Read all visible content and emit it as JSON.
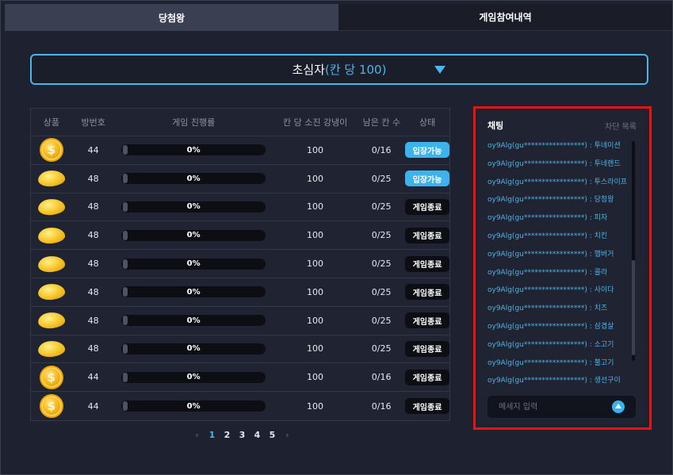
{
  "tabs": [
    {
      "label": "당첨왕",
      "active": true
    },
    {
      "label": "게임참여내역",
      "active": false
    }
  ],
  "selector": {
    "label_main": "초심자",
    "label_accent": "(칸 당 100)"
  },
  "table": {
    "headers": [
      "상품",
      "방번호",
      "게임 진행률",
      "칸 당 소진 강냉이",
      "남은 칸 수",
      "상태"
    ],
    "rows": [
      {
        "prize_icon": "coin-icon",
        "room": "44",
        "progress": "0%",
        "cost": "100",
        "remaining": "0/16",
        "status": "입장가능",
        "status_type": "open"
      },
      {
        "prize_icon": "gold-nugget-icon",
        "room": "48",
        "progress": "0%",
        "cost": "100",
        "remaining": "0/25",
        "status": "입장가능",
        "status_type": "open"
      },
      {
        "prize_icon": "gold-nugget-icon",
        "room": "48",
        "progress": "0%",
        "cost": "100",
        "remaining": "0/25",
        "status": "게임종료",
        "status_type": "end"
      },
      {
        "prize_icon": "gold-nugget-icon",
        "room": "48",
        "progress": "0%",
        "cost": "100",
        "remaining": "0/25",
        "status": "게임종료",
        "status_type": "end"
      },
      {
        "prize_icon": "gold-nugget-icon",
        "room": "48",
        "progress": "0%",
        "cost": "100",
        "remaining": "0/25",
        "status": "게임종료",
        "status_type": "end"
      },
      {
        "prize_icon": "gold-nugget-icon",
        "room": "48",
        "progress": "0%",
        "cost": "100",
        "remaining": "0/25",
        "status": "게임종료",
        "status_type": "end"
      },
      {
        "prize_icon": "gold-nugget-icon",
        "room": "48",
        "progress": "0%",
        "cost": "100",
        "remaining": "0/25",
        "status": "게임종료",
        "status_type": "end"
      },
      {
        "prize_icon": "gold-nugget-icon",
        "room": "48",
        "progress": "0%",
        "cost": "100",
        "remaining": "0/25",
        "status": "게임종료",
        "status_type": "end"
      },
      {
        "prize_icon": "coin-icon",
        "room": "44",
        "progress": "0%",
        "cost": "100",
        "remaining": "0/16",
        "status": "게임종료",
        "status_type": "end"
      },
      {
        "prize_icon": "coin-icon",
        "room": "44",
        "progress": "0%",
        "cost": "100",
        "remaining": "0/16",
        "status": "게임종료",
        "status_type": "end"
      }
    ]
  },
  "pagination": {
    "prev": "‹",
    "next": "›",
    "pages": [
      "1",
      "2",
      "3",
      "4",
      "5"
    ],
    "current": "1"
  },
  "chat": {
    "title": "채팅",
    "block_list": "차단 목록",
    "messages": [
      "oy9Alg(gu*****************) : 투네이션",
      "oy9Alg(gu*****************) : 투네랜드",
      "oy9Alg(gu*****************) : 투스라이프",
      "oy9Alg(gu*****************) : 당첨왕",
      "oy9Alg(gu*****************) : 피자",
      "oy9Alg(gu*****************) : 치킨",
      "oy9Alg(gu*****************) : 햄버거",
      "oy9Alg(gu*****************) : 콜라",
      "oy9Alg(gu*****************) : 사이다",
      "oy9Alg(gu*****************) : 치즈",
      "oy9Alg(gu*****************) : 삼겹살",
      "oy9Alg(gu*****************) : 소고기",
      "oy9Alg(gu*****************) : 불고기",
      "oy9Alg(gu*****************) : 생선구이"
    ],
    "input_placeholder": "메세지 입력",
    "send_icon": "arrow-up-icon"
  },
  "colors": {
    "accent": "#4fb4e6",
    "highlight_outline": "#e81414",
    "background": "#1d2130"
  }
}
